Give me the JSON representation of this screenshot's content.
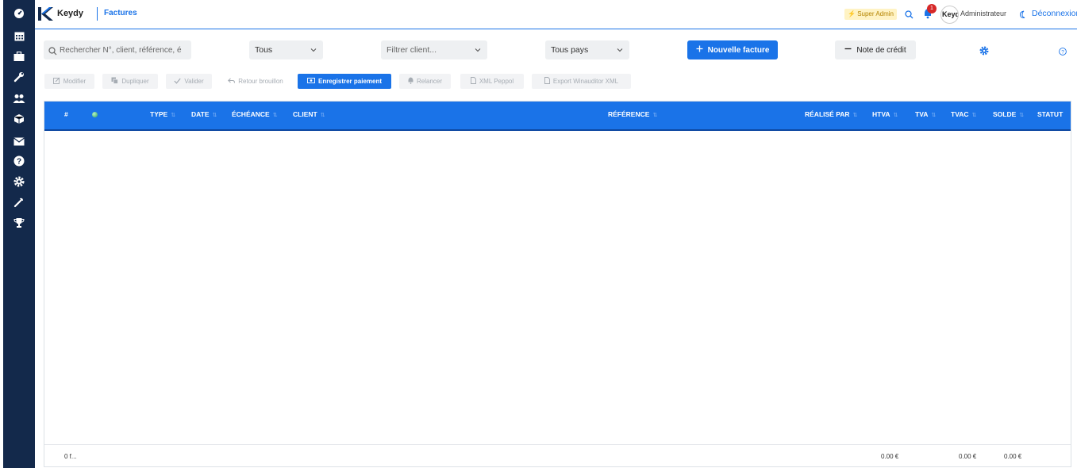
{
  "app": {
    "name": "Keydy",
    "page_title": "Factures",
    "accent": "#1a73e8",
    "sidebar_bg": "#13294b"
  },
  "sidebar": {
    "icons": [
      "dashboard-icon",
      "calendar-icon",
      "briefcase-icon",
      "wrench-icon",
      "users-icon",
      "box-icon",
      "envelope-icon",
      "help-icon",
      "settings-icon",
      "tools-icon",
      "trophy-icon"
    ]
  },
  "header": {
    "badge": "Super Admin",
    "notification_count": "1",
    "avatar_text": "Keydy",
    "role": "Administrateur",
    "logout": "Déconnexion"
  },
  "filters": {
    "search_placeholder": "Rechercher N°, client, référence, é",
    "status_select": "Tous",
    "client_select": "Filtrer client...",
    "country_select": "Tous pays",
    "new_invoice": "Nouvelle facture",
    "credit_note": "Note de crédit"
  },
  "actions": {
    "modify": "Modifier",
    "duplicate": "Dupliquer",
    "validate": "Valider",
    "back_to_draft": "Retour brouillon",
    "record_payment": "Enregistrer paiement",
    "remind": "Relancer",
    "xml_peppol": "XML Peppol",
    "export_winauditor": "Export Winauditor XML"
  },
  "table": {
    "columns": {
      "number": "#",
      "type": "TYPE",
      "date": "DATE",
      "due": "ÉCHÉANCE",
      "client": "CLIENT",
      "reference": "RÉFÉRENCE",
      "made_by": "RÉALISÉ PAR",
      "htva": "HTVA",
      "tva": "TVA",
      "tvac": "TVAC",
      "balance": "SOLDE",
      "status": "STATUT"
    },
    "rows": [],
    "footer": {
      "count": "0 f...",
      "htva_total": "0.00 €",
      "tvac_total": "0.00 €",
      "balance_total": "0.00 €"
    }
  }
}
